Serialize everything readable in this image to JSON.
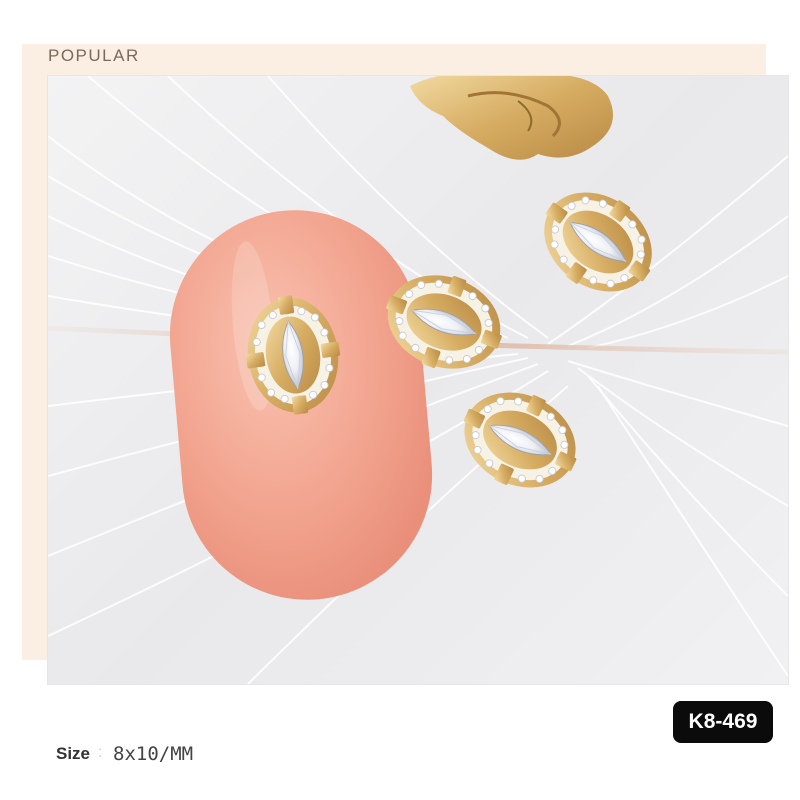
{
  "header": {
    "label": "POPULAR"
  },
  "product": {
    "code": "K8-469"
  },
  "spec": {
    "size_label": "Size",
    "separator": ":",
    "size_value": "8x10/MM"
  },
  "colors": {
    "accent_band": "#fbeee2",
    "nail": "#f2a48f",
    "gold": "#d9b26a",
    "badge_bg": "#0b0b0b"
  }
}
